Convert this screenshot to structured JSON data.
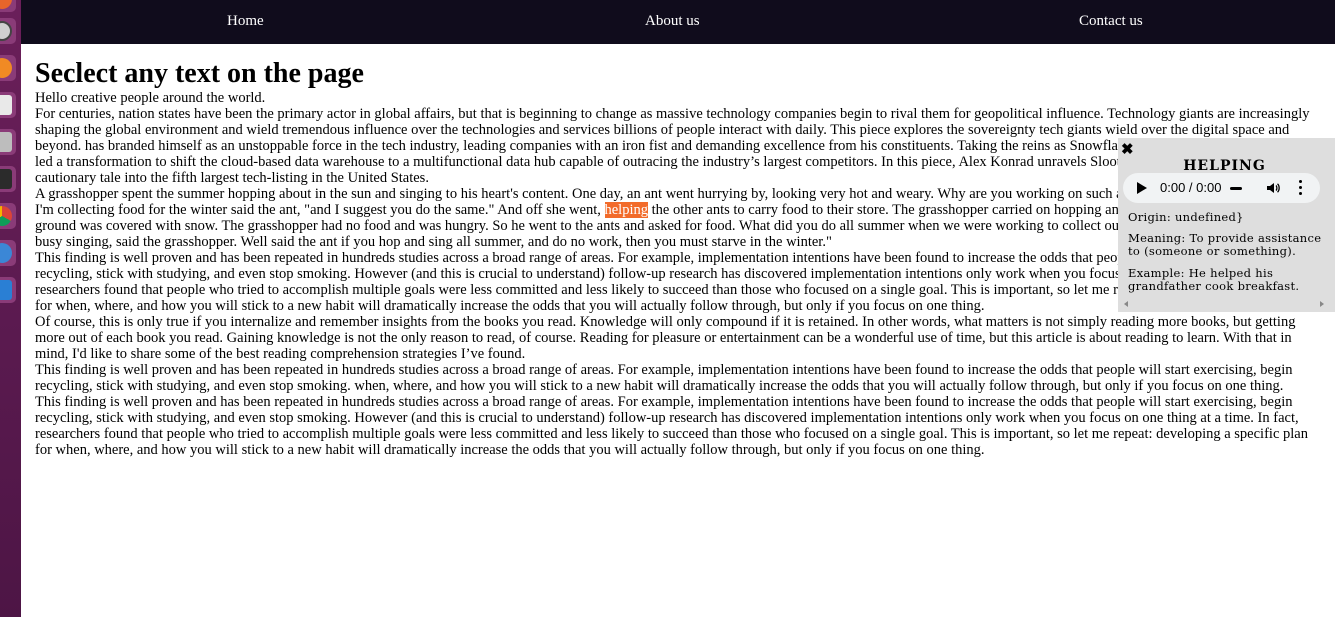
{
  "nav": {
    "home": "Home",
    "about": "About us",
    "contact": "Contact us"
  },
  "page": {
    "title": "Seclect any text on the page",
    "intro": "Hello creative people around the world.",
    "p1": "For centuries, nation states have been the primary actor in global affairs, but that is beginning to change as massive technology companies begin to rival them for geopolitical influence. Technology giants are increasingly shaping the global environment and wield tremendous influence over the technologies and services billions of people interact with daily. This piece explores the sovereignty tech giants wield over the digital space and beyond. has branded himself as an unstoppable force in the tech industry, leading companies with an iron fist and demanding excellence from his constituents. Taking the reins as Snowflake’s CEO in 2019, Slootman has led a transformation to shift the cloud-based data warehouse to a multifunctional data hub capable of outracing the industry’s largest competitors. In this piece, Alex Konrad unravels Slootman’s playbook, which turned a cautionary tale into the fifth largest tech-listing in the United States.",
    "p2_before": "A grasshopper spent the summer hopping about in the sun and singing to his heart's content. One day, an ant went hurrying by, looking very hot and weary. Why are you working on such a lovely day? said the grasshopper. I'm collecting food for the winter said the ant, \"and I suggest you do the same.\" And off she went, ",
    "p2_highlight": "helping",
    "p2_after": " the other ants to carry food to their store. The grasshopper carried on hopping and singing. When winter came the ground was covered with snow. The grasshopper had no food and was hungry. So he went to the ants and asked for food. What did you do all summer when we were working to collect our said one of the ants? We were busy singing, said the grasshopper. Well said the ant if you hop and sing all summer, and do no work, then you must starve in the winter.\"",
    "p3": "This finding is well proven and has been repeated in hundreds studies across a broad range of areas. For example, implementation intentions have been found to increase the odds that people will start exercising, begin recycling, stick with studying, and even stop smoking. However (and this is crucial to understand) follow-up research has discovered implementation intentions only work when you focus on one thing at a time. In fact, researchers found that people who tried to accomplish multiple goals were less committed and less likely to succeed than those who focused on a single goal. This is important, so let me repeat: developing a specific plan for when, where, and how you will stick to a new habit will dramatically increase the odds that you will actually follow through, but only if you focus on one thing.",
    "p4": "Of course, this is only true if you internalize and remember insights from the books you read. Knowledge will only compound if it is retained. In other words, what matters is not simply reading more books, but getting more out of each book you read. Gaining knowledge is not the only reason to read, of course. Reading for pleasure or entertainment can be a wonderful use of time, but this article is about reading to learn. With that in mind, I'd like to share some of the best reading comprehension strategies I’ve found.",
    "p5": "This finding is well proven and has been repeated in hundreds studies across a broad range of areas. For example, implementation intentions have been found to increase the odds that people will start exercising, begin recycling, stick with studying, and even stop smoking. when, where, and how you will stick to a new habit will dramatically increase the odds that you will actually follow through, but only if you focus on one thing.",
    "p6": "This finding is well proven and has been repeated in hundreds studies across a broad range of areas. For example, implementation intentions have been found to increase the odds that people will start exercising, begin recycling, stick with studying, and even stop smoking. However (and this is crucial to understand) follow-up research has discovered implementation intentions only work when you focus on one thing at a time. In fact, researchers found that people who tried to accomplish multiple goals were less committed and less likely to succeed than those who focused on a single goal. This is important, so let me repeat: developing a specific plan for when, where, and how you will stick to a new habit will dramatically increase the odds that you will actually follow through, but only if you focus on one thing."
  },
  "popup": {
    "close_glyph": "✖",
    "word": "HELPING",
    "audio_time": "0:00 / 0:00",
    "origin": "Origin: undefined}",
    "meaning": "Meaning: To provide assistance to (someone or something).",
    "example": "Example: He helped his grandfather cook breakfast."
  },
  "colors": {
    "navbar_bg": "#100c1c",
    "highlight_bg": "#f26b2a",
    "popup_bg": "#dedede",
    "dock_bg": "#5a1a4f"
  }
}
